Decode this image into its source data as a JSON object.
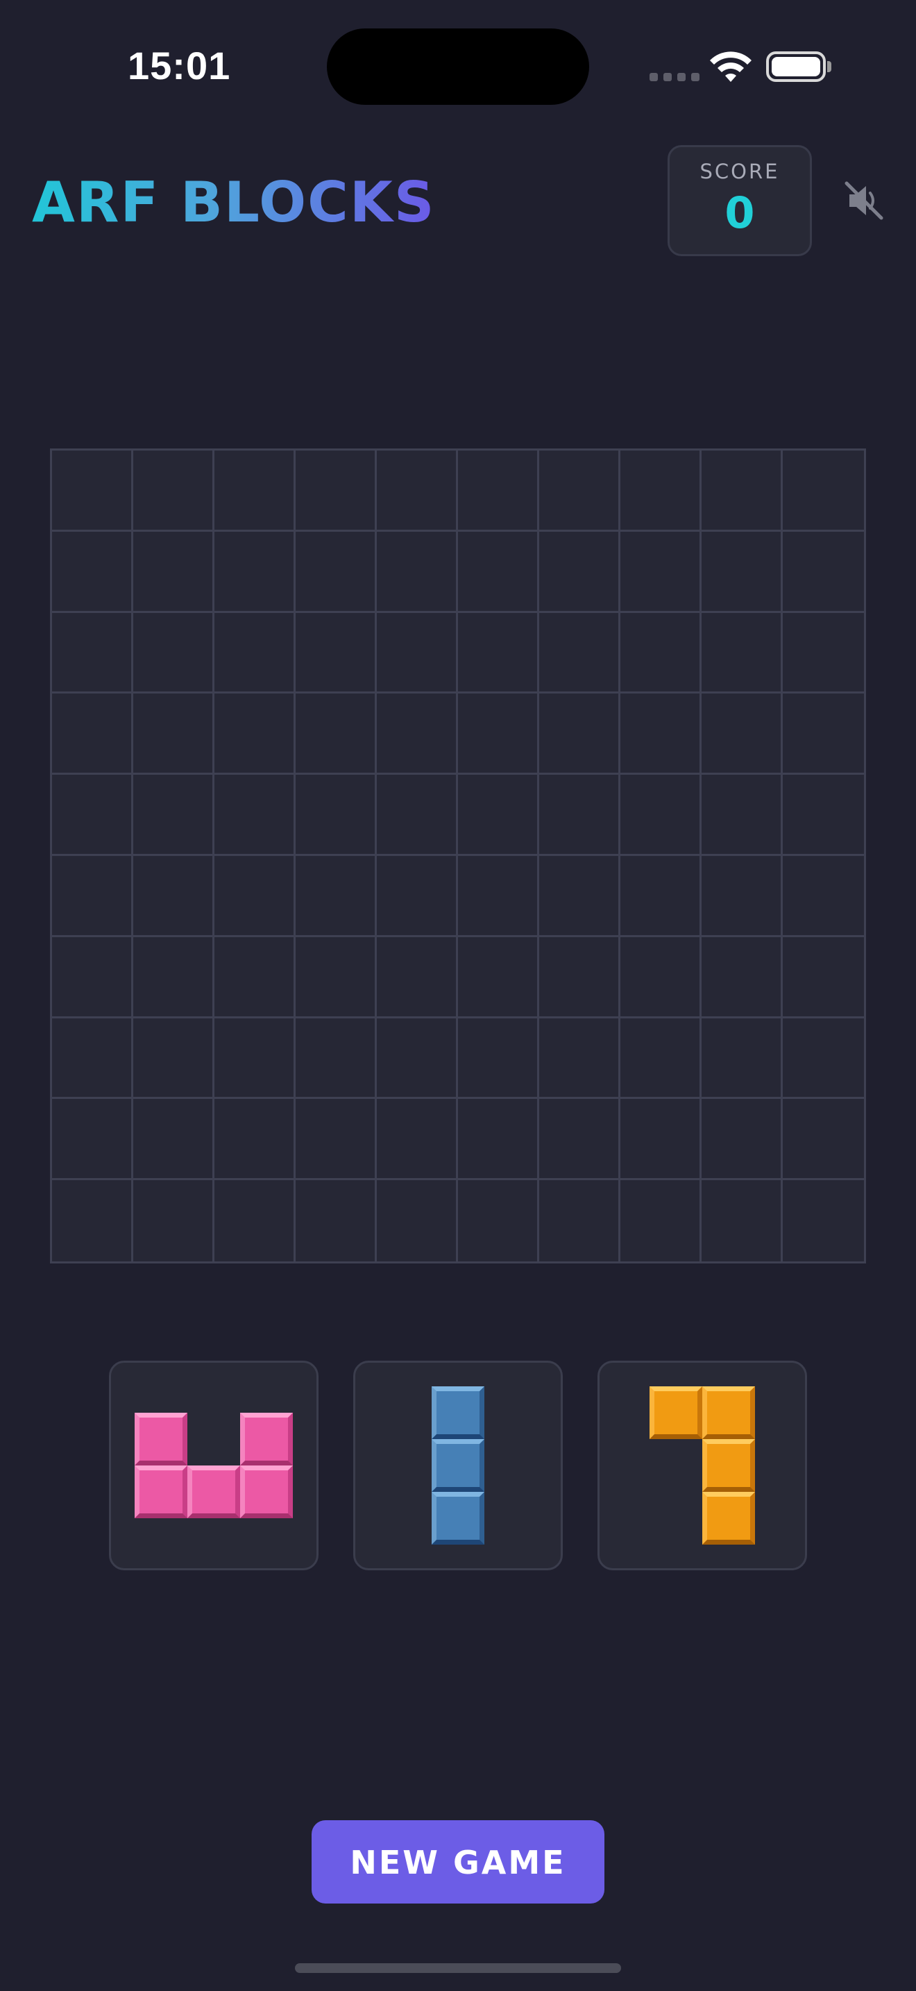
{
  "status_bar": {
    "time": "15:01"
  },
  "header": {
    "title": "ARF BLOCKS",
    "score_label": "SCORE",
    "score_value": "0",
    "mute_icon": "speaker-muted-icon"
  },
  "board": {
    "rows": 10,
    "cols": 10,
    "filled_cells": []
  },
  "pieces": [
    {
      "name": "u-piece",
      "color": "#ec59a5",
      "color_name": "pink",
      "cells": [
        [
          0,
          0
        ],
        [
          0,
          2
        ],
        [
          1,
          0
        ],
        [
          1,
          1
        ],
        [
          1,
          2
        ]
      ]
    },
    {
      "name": "i3-piece",
      "color": "#4680b6",
      "color_name": "blue",
      "cells": [
        [
          0,
          0
        ],
        [
          1,
          0
        ],
        [
          2,
          0
        ]
      ]
    },
    {
      "name": "j-piece",
      "color": "#f19b12",
      "color_name": "orange",
      "cells": [
        [
          0,
          0
        ],
        [
          0,
          1
        ],
        [
          1,
          1
        ],
        [
          2,
          1
        ]
      ]
    }
  ],
  "actions": {
    "new_game_label": "NEW GAME"
  },
  "colors": {
    "background": "#1f1f2e",
    "board_bg": "#262735",
    "grid_line": "#3e4052",
    "score_accent": "#21d0d8",
    "button": "#6c5de6"
  }
}
